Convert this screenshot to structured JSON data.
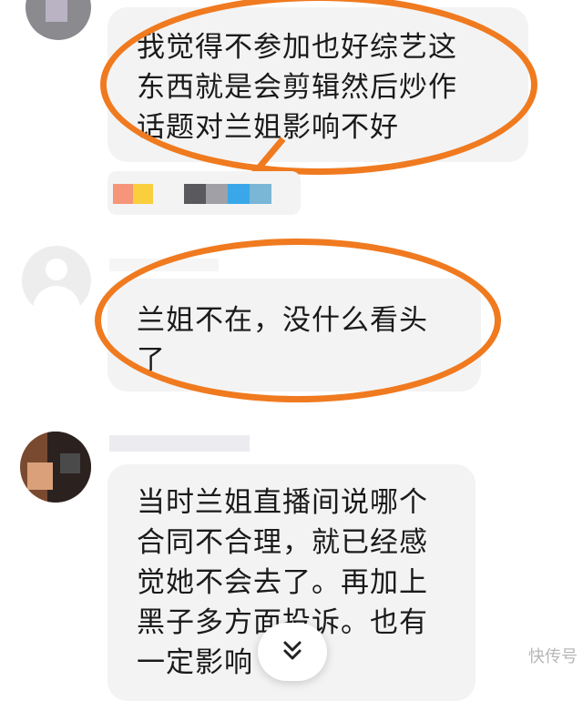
{
  "messages": [
    {
      "text": "我觉得不参加也好综艺这\n东西就是会剪辑然后炒作\n话题对兰姐影响不好"
    },
    {
      "text": "兰姐不在，没什么看头\n了"
    },
    {
      "text": "当时兰姐直播间说哪个\n合同不合理，就已经感\n觉她不会去了。再加上\n黑子多方面投诉。也有\n一定影响"
    }
  ],
  "scroll_icon": "chevron-double-down-icon",
  "watermark": "快传号",
  "colors": {
    "highlight": "#f07a1f",
    "bubble": "#f3f3f3"
  }
}
